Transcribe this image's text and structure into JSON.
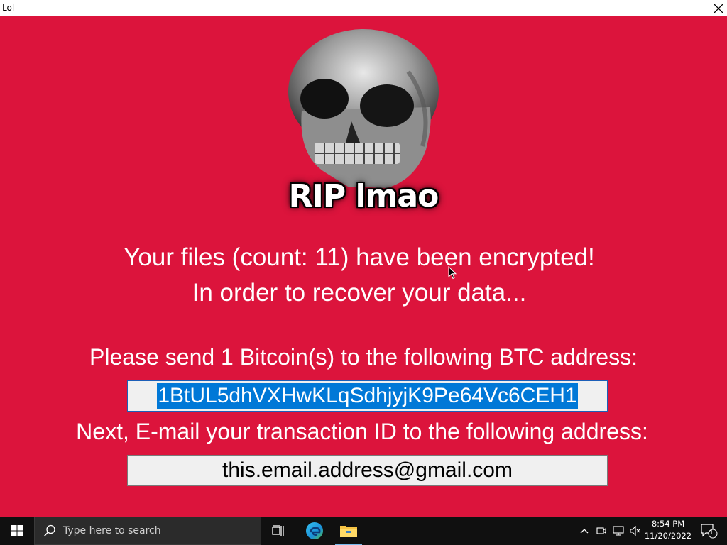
{
  "window": {
    "title": "Lol"
  },
  "ransom": {
    "logo_text": "RIP lmao",
    "line1": "Your files (count: 11) have been encrypted!",
    "line2": "In order to recover your data...",
    "line3": "Please send 1 Bitcoin(s) to the following BTC address:",
    "btc_address": "1BtUL5dhVXHwKLqSdhjyjK9Pe64Vc6CEH1",
    "line4": "Next, E-mail your transaction ID to the following address:",
    "email_address": "this.email.address@gmail.com"
  },
  "taskbar": {
    "search_placeholder": "Type here to search",
    "time": "8:54 PM",
    "date": "11/20/2022",
    "notification_count": "1"
  },
  "colors": {
    "background": "#dc143c",
    "selection": "#0078d7",
    "taskbar": "#101010"
  }
}
